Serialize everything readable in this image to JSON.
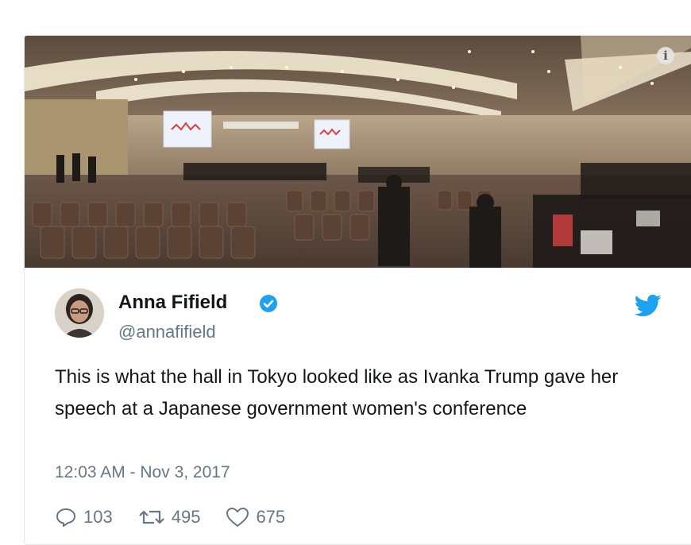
{
  "tweet": {
    "author_name": "Anna Fifield",
    "handle": "@annafifield",
    "text": "This is what the hall in Tokyo looked like as Ivanka Trump gave her speech at a Japanese government women's conference",
    "timestamp": "12:03 AM - Nov 3, 2017",
    "reply_count": "103",
    "retweet_count": "495",
    "like_count": "675",
    "info_glyph": "i"
  },
  "colors": {
    "twitter_blue": "#1da1f2",
    "secondary_text": "#657786",
    "primary_text": "#14171a"
  },
  "icons": [
    "info-icon",
    "verified-badge-icon",
    "twitter-bird-icon",
    "reply-icon",
    "retweet-icon",
    "like-icon"
  ]
}
